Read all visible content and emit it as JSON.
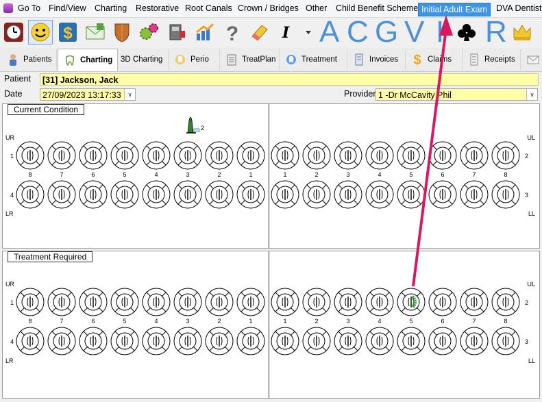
{
  "menu": {
    "items": [
      "Go To",
      "Find/View",
      "Charting",
      "Restorative",
      "Root Canals",
      "Crown / Bridges",
      "Other",
      "Child Benefit Scheme",
      "Initial Adult Exam",
      "DVA Dentist"
    ],
    "active_index": 8
  },
  "toolbar": {
    "icons": [
      "clock-icon",
      "smiley-icon",
      "dollar-icon",
      "mail-icon",
      "shield-icon",
      "gears-icon",
      "xray-icon",
      "chart-growth-icon",
      "help-icon",
      "eraser-icon",
      "italic-icon",
      "dropdown-arrow-icon"
    ],
    "letters": [
      "A",
      "C",
      "G",
      "V",
      "I",
      "R"
    ],
    "extra_icons": [
      "club-icon",
      "crown-icon"
    ]
  },
  "tabs": [
    "Patients",
    "Charting",
    "3D Charting",
    "Perio",
    "TreatPlan",
    "Treatment",
    "Invoices",
    "Claims",
    "Receipts"
  ],
  "patient": {
    "label": "Patient",
    "value": "[31] Jackson, Jack"
  },
  "date": {
    "label": "Date",
    "value": "27/09/2023 13:17:33"
  },
  "provider": {
    "label": "Provider",
    "value": "1 -Dr McCavity Phil"
  },
  "current_condition": {
    "title": "Current Condition",
    "implant_label": "2",
    "quadrants": {
      "ur": "UR",
      "ul": "UL",
      "lr": "LR",
      "ll": "LL"
    },
    "row_nums": {
      "upper_left": "1",
      "upper_right": "2",
      "lower_left": "4",
      "lower_right": "3"
    },
    "tooth_numbers_right_to_center": [
      "8",
      "7",
      "6",
      "5",
      "4",
      "3",
      "2",
      "1"
    ],
    "tooth_numbers_center_to_left": [
      "1",
      "2",
      "3",
      "4",
      "5",
      "6",
      "7",
      "8"
    ]
  },
  "treatment_required": {
    "title": "Treatment Required",
    "quadrants": {
      "ur": "UR",
      "ul": "UL",
      "lr": "LR",
      "ll": "LL"
    },
    "row_nums": {
      "upper_left": "1",
      "upper_right": "2",
      "lower_left": "4",
      "lower_right": "3"
    },
    "tooth_numbers_right_to_center": [
      "8",
      "7",
      "6",
      "5",
      "4",
      "3",
      "2",
      "1"
    ],
    "tooth_numbers_center_to_left": [
      "1",
      "2",
      "3",
      "4",
      "5",
      "6",
      "7",
      "8"
    ],
    "marked_tooth": "2-5",
    "mark_color": "#2a9a2a"
  },
  "annotation": {
    "arrow_color": "#d8195f"
  }
}
